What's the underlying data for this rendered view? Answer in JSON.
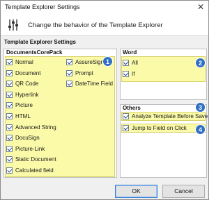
{
  "window": {
    "title": "Template Explorer Settings",
    "close_glyph": "✕",
    "header_text": "Change the behavior of the Template Explorer",
    "header_icon": "settings-sliders-icon"
  },
  "section_title": "Template Explorer Settings",
  "documentscorepack": {
    "label": "DocumentsCorePack",
    "col1": [
      "Normal",
      "Document",
      "QR Code",
      "Hyperlink",
      "Picture",
      "HTML",
      "Advanced String",
      "DocuSign",
      "Picture-Link",
      "Static Document",
      "Calculated field"
    ],
    "col2": [
      "AssureSign",
      "Prompt",
      "DateTime Field"
    ],
    "badge": "1"
  },
  "word": {
    "label": "Word",
    "items": [
      "All",
      "If"
    ],
    "badge": "2"
  },
  "others": {
    "label": "Others",
    "item1": "Analyze Template Before Save",
    "item2": "Jump to Field on Click",
    "badge1": "3",
    "badge2": "4"
  },
  "buttons": {
    "ok": "OK",
    "cancel": "Cancel"
  },
  "colors": {
    "highlight": "#fafaa8",
    "badge": "#2f6fc4"
  }
}
